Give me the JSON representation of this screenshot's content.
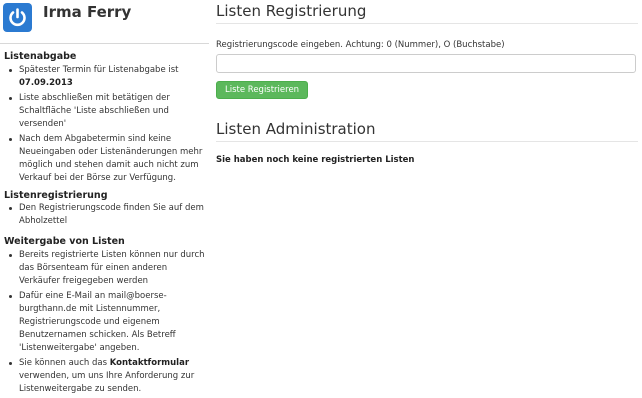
{
  "user": {
    "name": "Irma Ferry",
    "logo_icon": "power-icon",
    "logo_color": "#2b7ad1"
  },
  "sidebar": {
    "listenabgabe": {
      "title": "Listenabgabe",
      "deadline_text": "Spätester Termin für Listenabgabe ist",
      "deadline_date": "07.09.2013",
      "item2": "Liste abschließen mit betätigen der Schaltfläche 'Liste abschließen und versenden'",
      "item3": "Nach dem Abgabetermin sind keine Neueingaben oder Listenänderungen mehr möglich und stehen damit auch nicht zum Verkauf bei der Börse zur Verfügung."
    },
    "listenregistrierung": {
      "title": "Listenregistrierung",
      "item1": "Den Registrierungscode finden Sie auf dem Abholzettel"
    },
    "weitergabe": {
      "title": "Weitergabe von Listen",
      "item1": "Bereits registrierte Listen können nur durch das Börsenteam für einen anderen Verkäufer freigegeben werden",
      "item2": "Dafür eine E-Mail an mail@boerse-burgthann.de mit Listennummer, Registrierungscode und eigenem Benutzernamen schicken. Als Betreff 'Listenweitergabe' angeben.",
      "item3_prefix": "Sie können auch das",
      "item3_link": "Kontaktformular",
      "item3_suffix": "verwenden, um uns Ihre Anforderung zur Listenweitergabe zu senden."
    }
  },
  "main": {
    "registration": {
      "heading": "Listen Registrierung",
      "label": "Registrierungscode eingeben. Achtung: 0 (Nummer), O (Buchstabe)",
      "input_value": "",
      "button_label": "Liste Registrieren",
      "button_color": "#5cb85c"
    },
    "administration": {
      "heading": "Listen Administration",
      "empty_message": "Sie haben noch keine registrierten Listen"
    }
  }
}
